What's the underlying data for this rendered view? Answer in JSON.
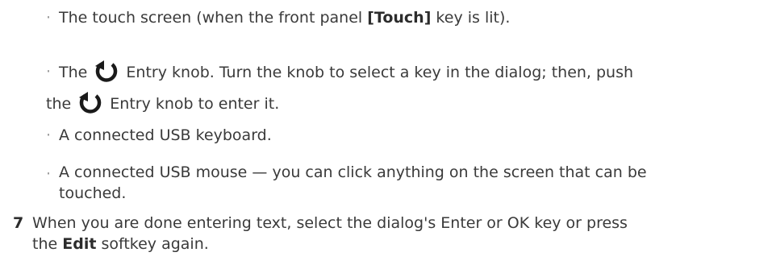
{
  "bullets": [
    {
      "dot": "·",
      "pre": "The touch screen (when the front panel ",
      "key": "[Touch]",
      "post": " key is lit)."
    },
    {
      "dot": "·",
      "line1_pre": "The ",
      "line1_post": " Entry knob. Turn the knob to select a key in the dialog; then, push",
      "line2_pre": "the ",
      "line2_post": " Entry knob to enter it.",
      "icon": "entry-knob-icon"
    },
    {
      "dot": "·",
      "text": "A connected USB keyboard."
    },
    {
      "dot": "·",
      "line1": "A connected USB mouse — you can click anything on the screen that can be",
      "line2": "touched."
    }
  ],
  "step": {
    "number": "7",
    "line1": "When you are done entering text, select the dialog's Enter or OK key or press",
    "line2_pre": "the ",
    "line2_key": "Edit",
    "line2_post": " softkey again."
  },
  "colors": {
    "text": "#3a3a3a",
    "bullet": "#9a9a9a",
    "icon": "#1a1a1a"
  }
}
